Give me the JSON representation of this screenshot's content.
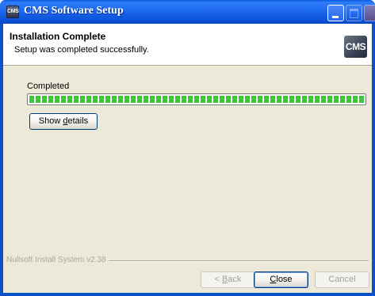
{
  "window": {
    "app_icon_text": "CMS",
    "title": "CMS Software Setup"
  },
  "header": {
    "title": "Installation Complete",
    "subtitle": "Setup was completed successfully.",
    "logo_text": "CMS"
  },
  "progress": {
    "status_label": "Completed",
    "percent": 100
  },
  "details_button": {
    "label_pre": "Show ",
    "label_mnemonic": "d",
    "label_post": "etails"
  },
  "branding": {
    "text": "Nullsoft Install System v2.38"
  },
  "footer": {
    "back": {
      "pre": "< ",
      "mnemonic": "B",
      "post": "ack",
      "enabled": false
    },
    "close": {
      "pre": "",
      "mnemonic": "C",
      "post": "lose",
      "enabled": true
    },
    "cancel": {
      "label": "Cancel",
      "enabled": false
    }
  },
  "colors": {
    "titlebar": "#0b53d8",
    "progress_green": "#3fc63a",
    "dialog_bg": "#ece9d8"
  }
}
